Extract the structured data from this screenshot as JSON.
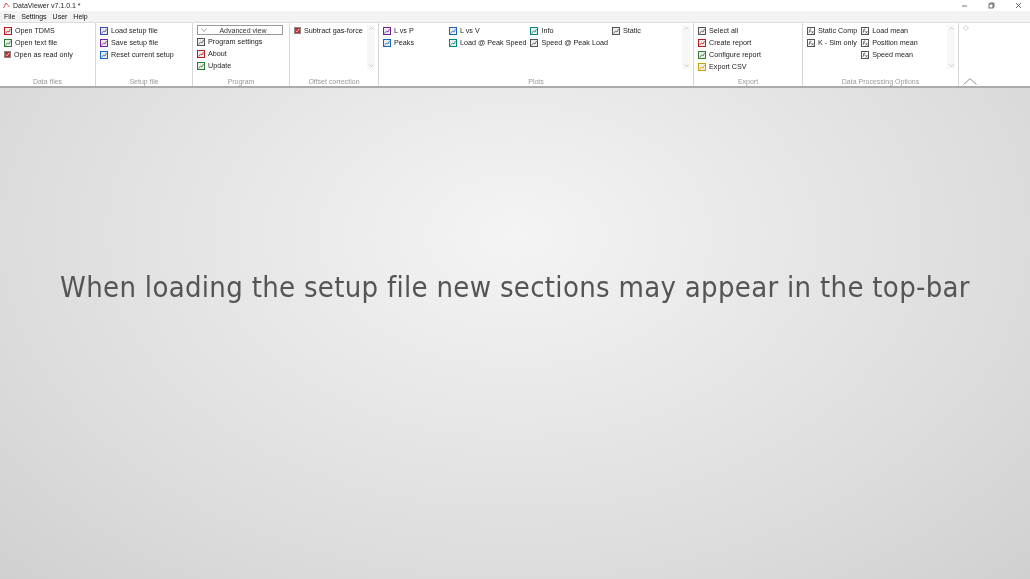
{
  "window": {
    "title": "DataViewer v7.1.0.1 *"
  },
  "menu": [
    "File",
    "Settings",
    "User",
    "Help"
  ],
  "ribbon": [
    {
      "label": "Data files",
      "scroll": false,
      "columns": [
        [
          {
            "label": "Open TDMS",
            "kind": "button"
          },
          {
            "label": "Open text file",
            "kind": "button"
          },
          {
            "label": "Open as read only",
            "kind": "checkbox",
            "checked": true
          }
        ]
      ]
    },
    {
      "label": "Setup file",
      "scroll": false,
      "columns": [
        [
          {
            "label": "Load setup file",
            "kind": "button"
          },
          {
            "label": "Save setup file",
            "kind": "button"
          },
          {
            "label": "Reset current setup",
            "kind": "button"
          }
        ]
      ]
    },
    {
      "label": "Program",
      "scroll": false,
      "columns": [
        [
          {
            "label": "Advanced view",
            "kind": "dropdown"
          },
          {
            "label": "Program settings",
            "kind": "button"
          },
          {
            "label": "About",
            "kind": "button"
          },
          {
            "label": "Update",
            "kind": "button"
          }
        ]
      ]
    },
    {
      "label": "Offset correction",
      "scroll": true,
      "columns": [
        [
          {
            "label": "Subtract gas-force",
            "kind": "checkbox",
            "checked": true
          }
        ]
      ]
    },
    {
      "label": "Plots",
      "scroll": true,
      "columns": [
        [
          {
            "label": "L vs P",
            "kind": "button"
          },
          {
            "label": "Peaks",
            "kind": "button"
          }
        ],
        [
          {
            "label": "L vs V",
            "kind": "button"
          },
          {
            "label": "Load @ Peak Speed",
            "kind": "button"
          }
        ],
        [
          {
            "label": "Info",
            "kind": "button"
          },
          {
            "label": "Speed @ Peak Load",
            "kind": "button"
          }
        ],
        [
          {
            "label": "Static",
            "kind": "button"
          }
        ]
      ]
    },
    {
      "label": "Export",
      "scroll": false,
      "columns": [
        [
          {
            "label": "Select all",
            "kind": "button"
          },
          {
            "label": "Create report",
            "kind": "button"
          },
          {
            "label": "Configure report",
            "kind": "button"
          },
          {
            "label": "Export CSV",
            "kind": "button"
          }
        ]
      ]
    },
    {
      "label": "Data Processing Options",
      "scroll": true,
      "columns": [
        [
          {
            "label": "Static Comp",
            "kind": "function"
          },
          {
            "label": "K - Sim only",
            "kind": "function"
          }
        ],
        [
          {
            "label": "Load mean",
            "kind": "function"
          },
          {
            "label": "Position mean",
            "kind": "function"
          },
          {
            "label": "Speed mean",
            "kind": "function"
          }
        ]
      ]
    }
  ],
  "message": "When loading the setup file new sections may appear in the top-bar"
}
